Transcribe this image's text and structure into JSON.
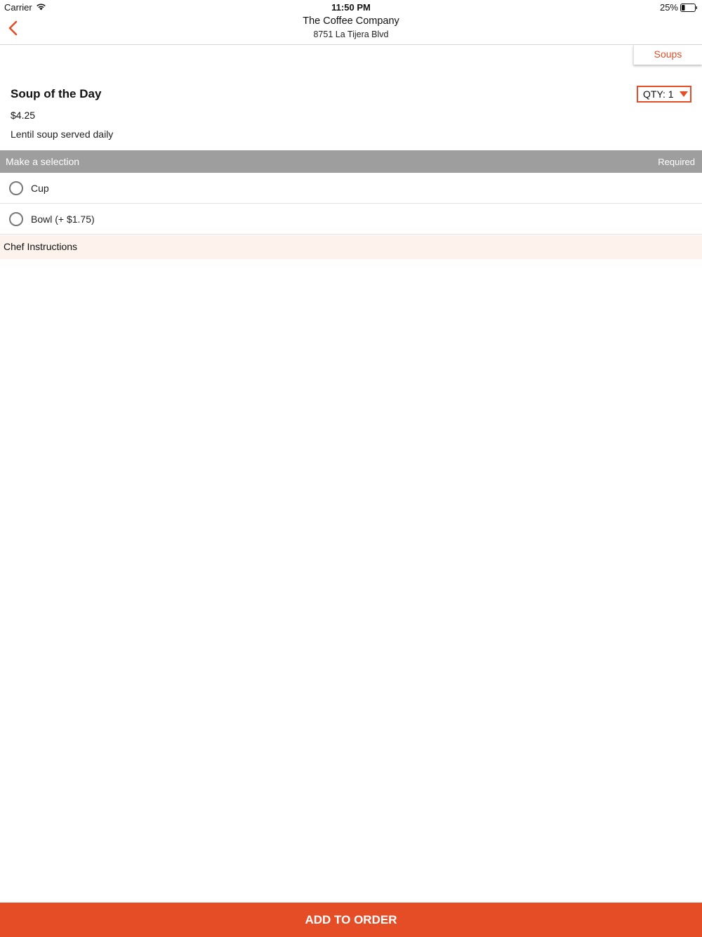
{
  "status_bar": {
    "carrier": "Carrier",
    "time": "11:50 PM",
    "battery": "25%",
    "battery_level": 0.25
  },
  "nav": {
    "title": "The Coffee Company",
    "subtitle": "8751 La Tijera Blvd",
    "back_icon": "chevron-left-icon"
  },
  "category_tab": {
    "label": "Soups"
  },
  "item": {
    "title": "Soup of the Day",
    "price": "$4.25",
    "description": "Lentil soup served daily",
    "qty_label": "QTY: 1"
  },
  "selection": {
    "title": "Make a selection",
    "required": "Required",
    "options": [
      {
        "label": "Cup",
        "selected": false
      },
      {
        "label": "Bowl (+ $1.75)",
        "selected": false
      }
    ]
  },
  "chef_instructions": {
    "label": "Chef Instructions"
  },
  "footer": {
    "add_label": "ADD TO ORDER"
  },
  "colors": {
    "accent": "#e44d26",
    "section_header": "#9e9e9e",
    "instructions_bg": "#fdf3ec"
  }
}
